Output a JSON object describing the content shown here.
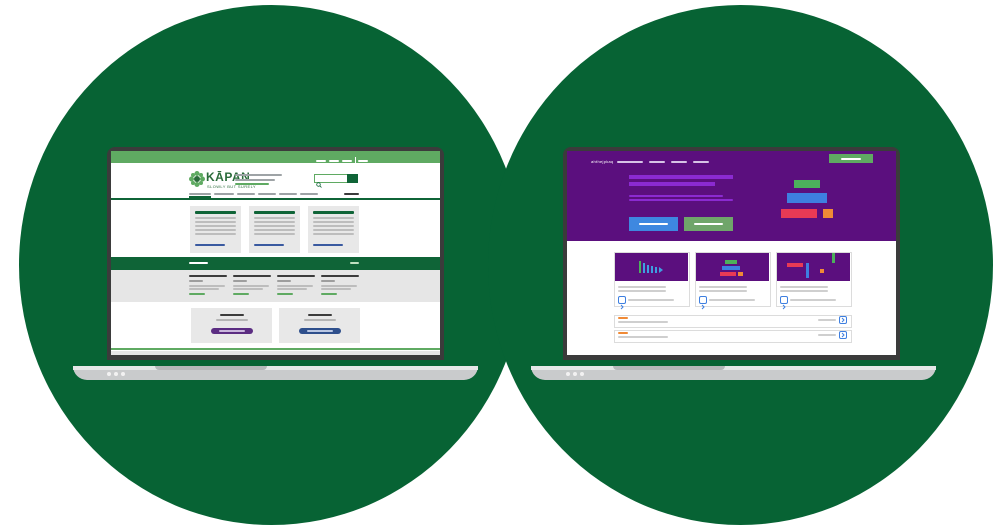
{
  "colors": {
    "circle": "#076334",
    "kapan_green": "#5faa62",
    "kapan_dark": "#0f6437",
    "purple": "#5b0f7e",
    "purple_accent": "#8b2ad1"
  },
  "left_site": {
    "logo_text": "KĀPAN",
    "logo_sub": "SLOWLY BUT SURELY",
    "search_icon": "search-icon"
  },
  "right_site": {
    "brand_text": "ahthejpkaq"
  }
}
